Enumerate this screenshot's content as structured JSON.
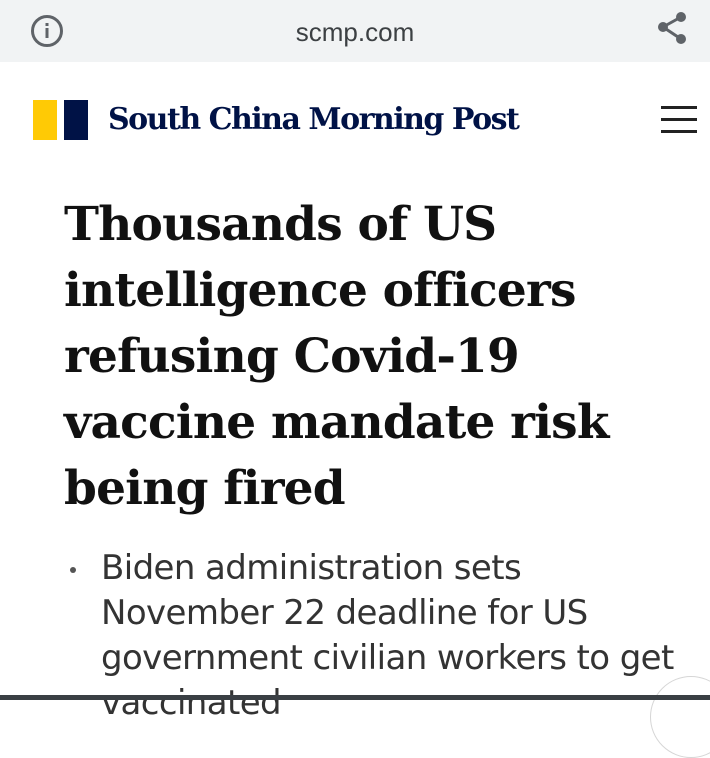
{
  "browser": {
    "url": "scmp.com",
    "info_icon": "info-icon",
    "share_icon": "share-icon"
  },
  "header": {
    "logo_text": "South China Morning Post",
    "logo_colors": [
      "#ffca05",
      "#001246"
    ],
    "menu_icon": "hamburger-menu-icon"
  },
  "article": {
    "headline": "Thousands of US intelligence officers refusing Covid-19 vaccine mandate risk being fired",
    "bullets": [
      "Biden administration sets November 22 deadline for US government civilian workers to get vaccinated"
    ]
  },
  "colors": {
    "brand_navy": "#001246",
    "brand_yellow": "#ffca05",
    "urlbar_bg": "#f1f3f4"
  }
}
